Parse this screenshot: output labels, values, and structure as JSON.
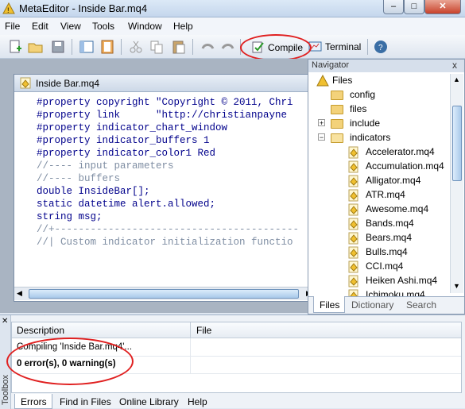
{
  "window": {
    "title": "MetaEditor - Inside Bar.mq4",
    "controls": {
      "minimize": "–",
      "maximize": "□",
      "close": "✕"
    }
  },
  "menu": [
    "File",
    "Edit",
    "View",
    "Tools",
    "Window",
    "Help"
  ],
  "toolbar": {
    "compile_label": "Compile",
    "terminal_label": "Terminal"
  },
  "editor": {
    "tab_title": "Inside Bar.mq4",
    "lines": [
      "#property copyright \"Copyright © 2011, Chri",
      "#property link      \"http://christianpayne",
      "",
      "#property indicator_chart_window",
      "#property indicator_buffers 1",
      "#property indicator_color1 Red",
      "//---- input parameters",
      "",
      "//---- buffers",
      "double InsideBar[];",
      "",
      "static datetime alert.allowed;",
      "string msg;",
      "//+-----------------------------------------",
      "//| Custom indicator initialization functio"
    ]
  },
  "navigator": {
    "title": "Navigator",
    "close": "x",
    "root": "Files",
    "folders": [
      "config",
      "files",
      "include",
      "indicators"
    ],
    "indicator_files": [
      "Accelerator.mq4",
      "Accumulation.mq4",
      "Alligator.mq4",
      "ATR.mq4",
      "Awesome.mq4",
      "Bands.mq4",
      "Bears.mq4",
      "Bulls.mq4",
      "CCI.mq4",
      "Heiken Ashi.mq4",
      "Ichimoku.mq4"
    ],
    "tabs": [
      "Files",
      "Dictionary",
      "Search"
    ]
  },
  "toolbox": {
    "side_label": "Toolbox",
    "columns": [
      "Description",
      "File"
    ],
    "rows": [
      {
        "description": "Compiling 'Inside Bar.mq4'...",
        "file": ""
      },
      {
        "description": "0 error(s), 0 warning(s)",
        "file": ""
      }
    ],
    "tabs": [
      "Errors",
      "Find in Files",
      "Online Library",
      "Help"
    ]
  },
  "colors": {
    "annotation": "#e02020",
    "accent": "#3a6ea5"
  }
}
